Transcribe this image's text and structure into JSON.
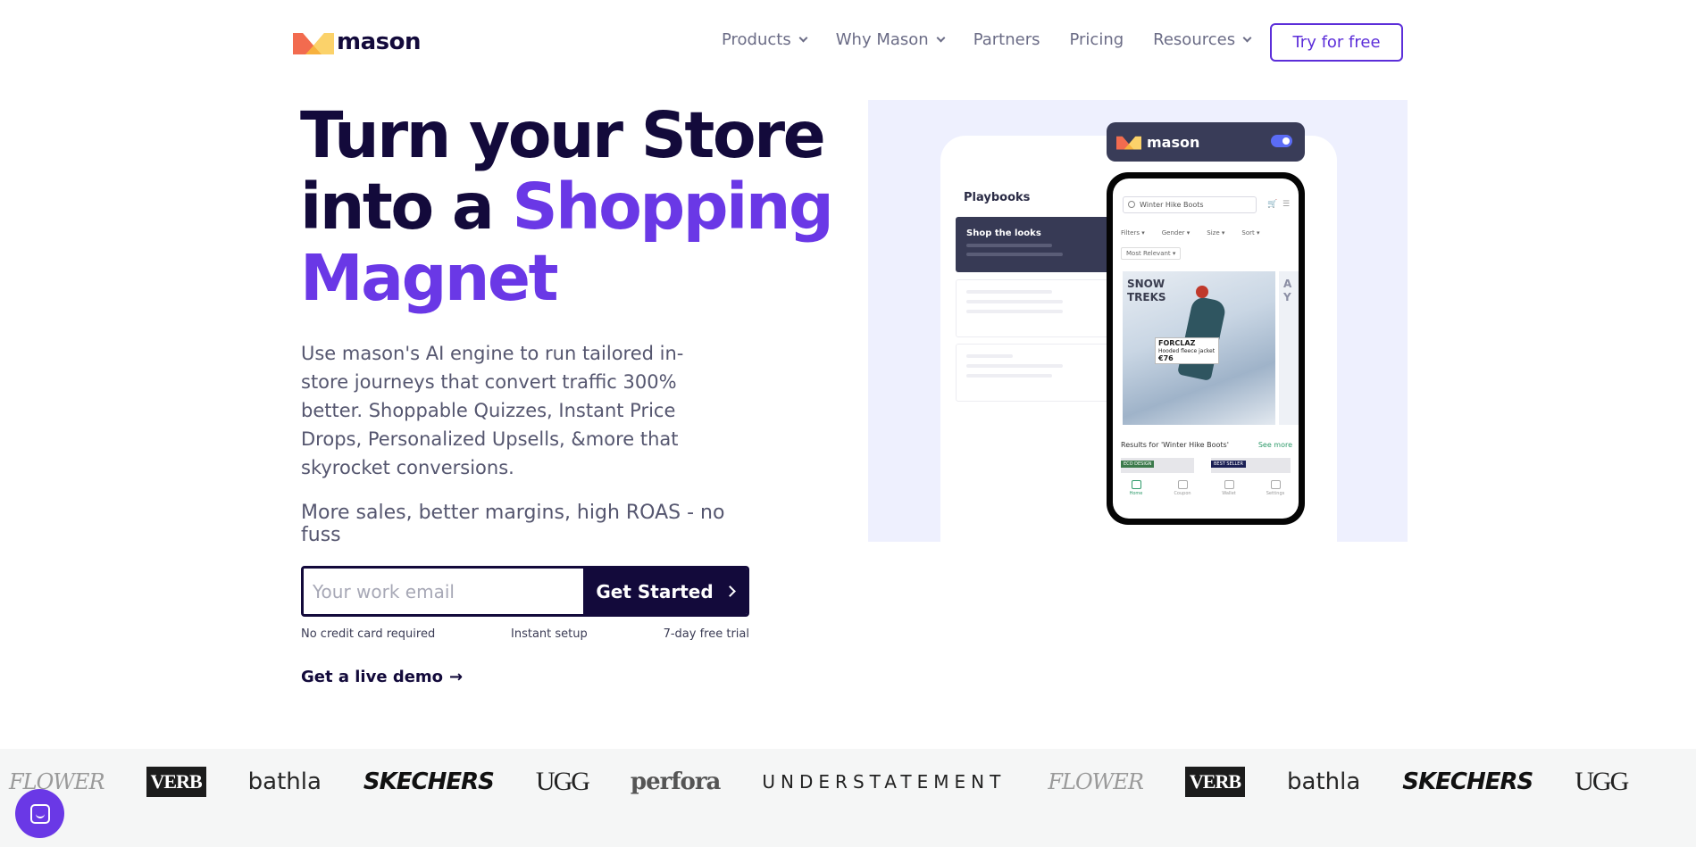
{
  "nav": {
    "brand": "mason",
    "items": [
      {
        "label": "Products",
        "dropdown": true
      },
      {
        "label": "Why Mason",
        "dropdown": true
      },
      {
        "label": "Partners",
        "dropdown": false
      },
      {
        "label": "Pricing",
        "dropdown": false
      },
      {
        "label": "Resources",
        "dropdown": true
      }
    ],
    "cta": "Try for free"
  },
  "hero": {
    "headline_1": "Turn your Store",
    "headline_2a": "into a ",
    "headline_2b": "Shopping",
    "headline_3": "Magnet",
    "subtext": "Use mason's AI engine to run tailored in-store journeys that convert traffic 300% better. Shoppable Quizzes, Instant Price Drops, Personalized Upsells, &more that skyrocket conversions.",
    "subtext2": "More sales, better margins, high ROAS - no fuss",
    "email_placeholder": "Your work email",
    "email_value": "",
    "submit_label": "Get Started",
    "perks": [
      "No credit card required",
      "Instant setup",
      "7-day free trial"
    ],
    "demo_link": "Get a live demo",
    "demo_arrow": "→"
  },
  "mockup": {
    "panel_title": "Playbooks",
    "active_playbook": "Shop the looks",
    "toolbar_brand": "mason",
    "toggle_on": true,
    "phone": {
      "search_value": "Winter Hike Boots",
      "filters": [
        "Filters ▾",
        "Gender ▾",
        "Size ▾",
        "Sort ▾"
      ],
      "sort_selected": "Most Relevant ▾",
      "banner_title_1": "SNOW",
      "banner_title_2": "TREKS",
      "product_brand": "FORCLAZ",
      "product_name": "Hooded fleece jacket",
      "product_price": "€76",
      "side_banner": "A\nY",
      "results_label": "Results for 'Winter Hike Boots'",
      "see_more": "See more",
      "badge_1": "ECO DESIGN",
      "badge_2": "BEST SELLER",
      "tabs": [
        "Home",
        "Coupon",
        "Wallet",
        "Settings"
      ]
    }
  },
  "logos": [
    "FLOWER",
    "VERB",
    "bathla",
    "SKECHERS",
    "UGG",
    "perfora",
    "UNDERSTATEMENT",
    "FLOWER",
    "VERB",
    "bathla",
    "SKECHERS",
    "UGG"
  ],
  "colors": {
    "primary_dark": "#130a3b",
    "accent_purple": "#6a38e6",
    "cta_border": "#5c2ed9",
    "hero_art_bg": "#eef0fe"
  }
}
